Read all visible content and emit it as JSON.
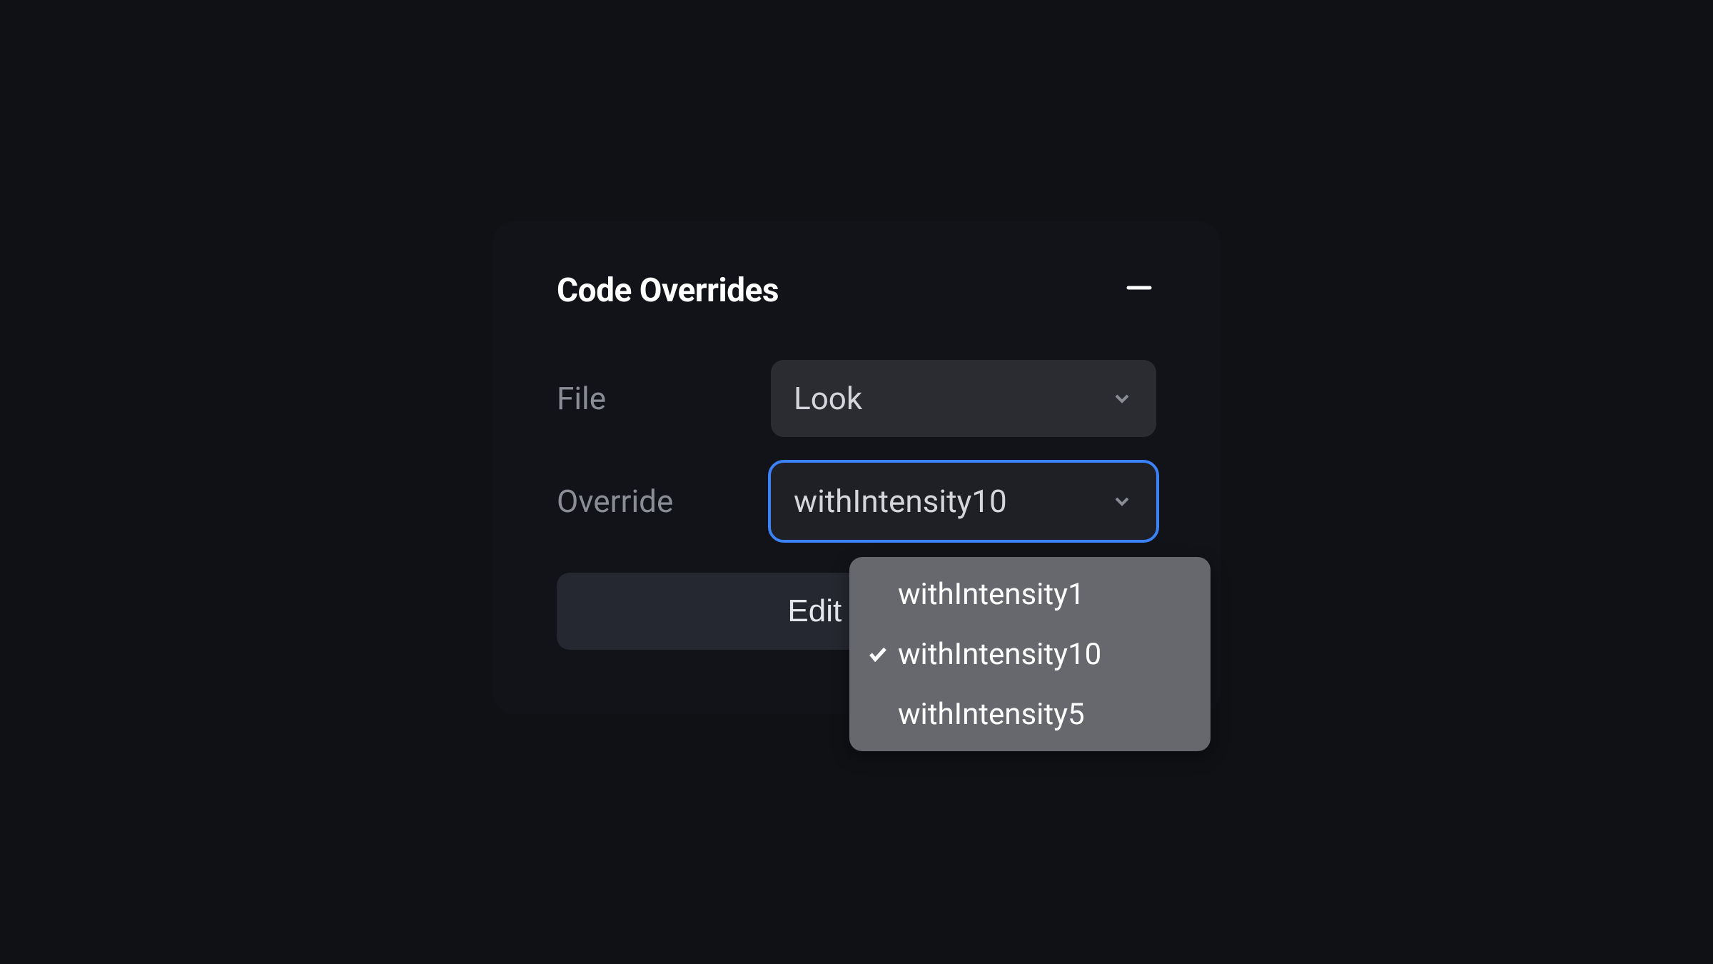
{
  "panel": {
    "title": "Code Overrides",
    "fields": {
      "file": {
        "label": "File",
        "value": "Look"
      },
      "override": {
        "label": "Override",
        "value": "withIntensity10"
      }
    },
    "edit_button_label": "Edit Code",
    "dropdown": {
      "options": [
        {
          "label": "withIntensity1",
          "selected": false
        },
        {
          "label": "withIntensity10",
          "selected": true
        },
        {
          "label": "withIntensity5",
          "selected": false
        }
      ]
    }
  }
}
